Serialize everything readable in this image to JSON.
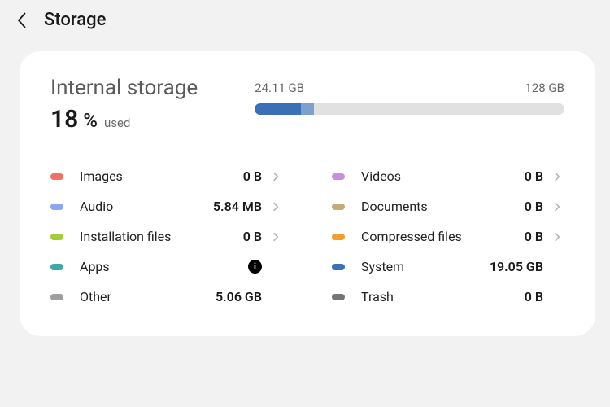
{
  "header": {
    "title": "Storage"
  },
  "storage": {
    "title": "Internal storage",
    "percent_value": "18",
    "percent_suffix": "%",
    "used_label": "used",
    "bar_used_label": "24.11 GB",
    "bar_total_label": "128 GB"
  },
  "bar_segments": [
    {
      "color": "#3b6fb6",
      "width_pct": 15
    },
    {
      "color": "#7ea0cc",
      "width_pct": 4
    }
  ],
  "categories_left": [
    {
      "label": "Images",
      "size": "0 B",
      "color": "#ed7265",
      "nav": true,
      "info": false
    },
    {
      "label": "Audio",
      "size": "5.84 MB",
      "color": "#8ea6ee",
      "nav": true,
      "info": false
    },
    {
      "label": "Installation files",
      "size": "0 B",
      "color": "#a2cc39",
      "nav": true,
      "info": false
    },
    {
      "label": "Apps",
      "size": "",
      "color": "#3fa7a7",
      "nav": false,
      "info": true
    },
    {
      "label": "Other",
      "size": "5.06 GB",
      "color": "#9e9e9e",
      "nav": false,
      "info": false
    }
  ],
  "categories_right": [
    {
      "label": "Videos",
      "size": "0 B",
      "color": "#c88fe0",
      "nav": true,
      "info": false
    },
    {
      "label": "Documents",
      "size": "0 B",
      "color": "#c7a97a",
      "nav": true,
      "info": false
    },
    {
      "label": "Compressed files",
      "size": "0 B",
      "color": "#f0a030",
      "nav": true,
      "info": false
    },
    {
      "label": "System",
      "size": "19.05 GB",
      "color": "#3b6fb6",
      "nav": false,
      "info": false
    },
    {
      "label": "Trash",
      "size": "0 B",
      "color": "#757575",
      "nav": false,
      "info": false
    }
  ]
}
